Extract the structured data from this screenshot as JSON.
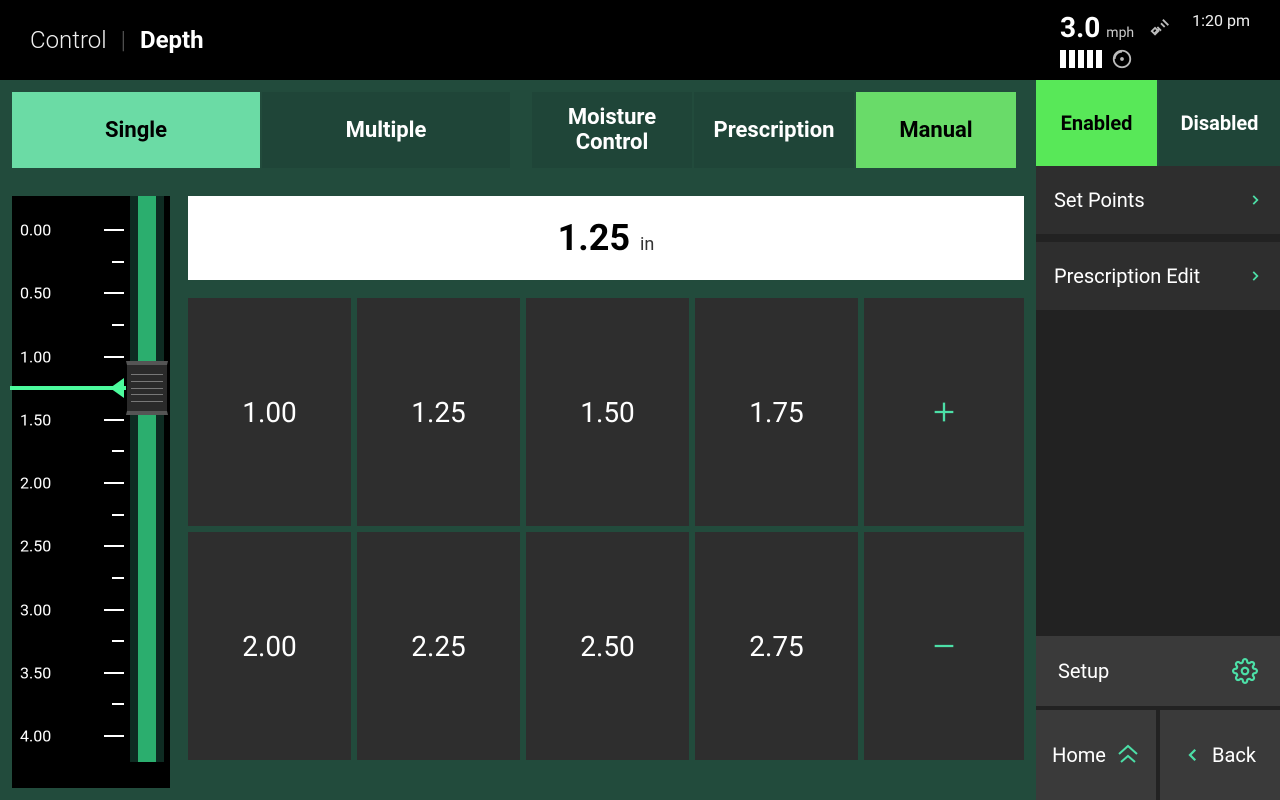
{
  "header": {
    "breadcrumb_root": "Control",
    "breadcrumb_current": "Depth"
  },
  "status": {
    "speed_value": "3.0",
    "speed_unit": "mph",
    "signal_bars": 5,
    "time": "1:20 pm"
  },
  "tabs": {
    "view": [
      {
        "id": "single",
        "label": "Single",
        "active": true
      },
      {
        "id": "multiple",
        "label": "Multiple",
        "active": false
      }
    ],
    "mode": [
      {
        "id": "moisture",
        "label": "Moisture Control",
        "active": false
      },
      {
        "id": "prescription",
        "label": "Prescription",
        "active": false
      },
      {
        "id": "manual",
        "label": "Manual",
        "active": true
      }
    ]
  },
  "gauge": {
    "ticks": [
      "0.00",
      "0.50",
      "1.00",
      "1.50",
      "2.00",
      "2.50",
      "3.00",
      "3.50",
      "4.00"
    ],
    "pointer_value": 1.25,
    "min": 0.0,
    "max": 4.0
  },
  "current": {
    "value": "1.25",
    "unit": "in"
  },
  "presets": [
    "1.00",
    "1.25",
    "1.50",
    "1.75",
    "2.00",
    "2.25",
    "2.50",
    "2.75"
  ],
  "math": {
    "increase_icon": "plus-icon",
    "decrease_icon": "minus-icon"
  },
  "enable_toggle": {
    "enabled_label": "Enabled",
    "disabled_label": "Disabled",
    "state": "enabled"
  },
  "right_menu": [
    {
      "id": "setpoints",
      "label": "Set Points"
    },
    {
      "id": "rxedit",
      "label": "Prescription Edit"
    }
  ],
  "footer": {
    "setup_label": "Setup",
    "home_label": "Home",
    "back_label": "Back"
  }
}
